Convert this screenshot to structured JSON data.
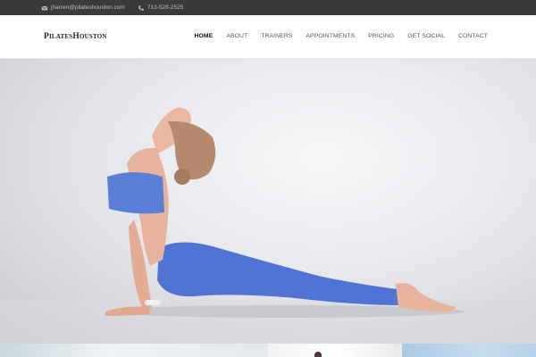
{
  "topbar": {
    "email": "jharren@pilateshouston.com",
    "phone": "713-528-2525",
    "email_icon": "envelope-icon",
    "phone_icon": "phone-icon"
  },
  "header": {
    "logo": "PilatesHouston",
    "nav": [
      {
        "label": "HOME",
        "active": true
      },
      {
        "label": "ABOUT"
      },
      {
        "label": "TRAINERS"
      },
      {
        "label": "APPOINTMENTS"
      },
      {
        "label": "PRICING"
      },
      {
        "label": "GET SOCIAL"
      },
      {
        "label": "CONTACT"
      }
    ]
  },
  "colors": {
    "topbar_bg": "#3a3a3a",
    "leggings": "#4f74d4",
    "top": "#5a7fd8",
    "skin": "#e6b49e"
  }
}
